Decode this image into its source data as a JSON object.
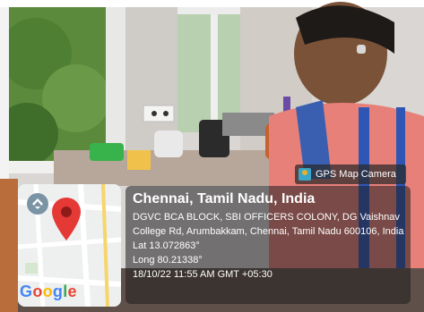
{
  "photo": {
    "description_icon": "scene-photo"
  },
  "badge": {
    "label": "GPS Map Camera",
    "icon": "gps-map-camera-icon"
  },
  "map": {
    "logo_letters": [
      "G",
      "o",
      "o",
      "g",
      "l",
      "e"
    ],
    "logo_colors": [
      "#4285F4",
      "#EA4335",
      "#FBBC05",
      "#4285F4",
      "#34A853",
      "#EA4335"
    ],
    "pin_color": "#E53935",
    "marker_icon": "location-pin-icon"
  },
  "info": {
    "title": "Chennai, Tamil Nadu, India",
    "address": "DGVC BCA BLOCK, SBI OFFICERS COLONY, DG Vaishnav College Rd, Arumbakkam, Chennai, Tamil Nadu 600106, India",
    "lat": "Lat 13.072863°",
    "long": "Long 80.21338°",
    "datetime": "18/10/22 11:55 AM GMT +05:30"
  }
}
